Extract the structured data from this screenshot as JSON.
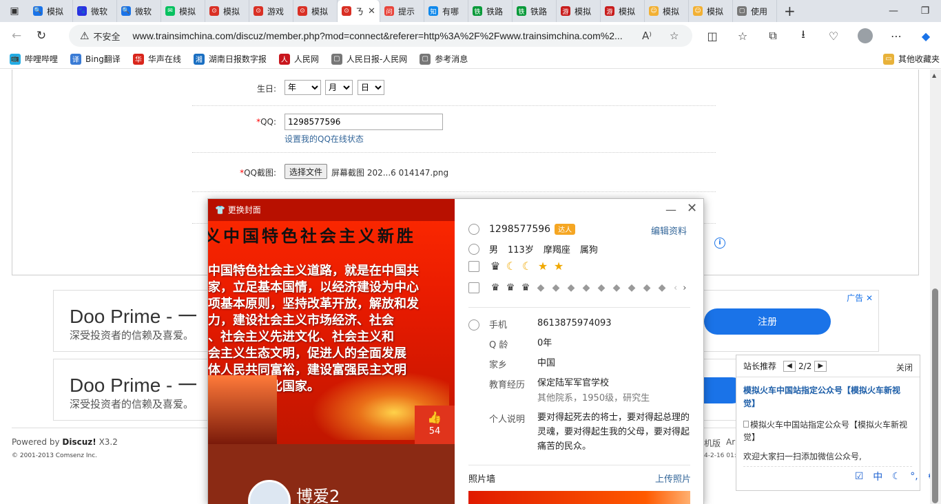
{
  "browser": {
    "tabs": [
      {
        "label": "模拟",
        "color": "#1a73e8",
        "glyph": "🔍"
      },
      {
        "label": "微软",
        "color": "#2932e1",
        "glyph": "🐾"
      },
      {
        "label": "微软",
        "color": "#1a73e8",
        "glyph": "🔍"
      },
      {
        "label": "模拟",
        "color": "#07c160",
        "glyph": "✉"
      },
      {
        "label": "模拟",
        "color": "#d93025",
        "glyph": "⊙"
      },
      {
        "label": "游戏",
        "color": "#d93025",
        "glyph": "⊙"
      },
      {
        "label": "模拟",
        "color": "#d93025",
        "glyph": "⊙"
      },
      {
        "label": "ㄋ",
        "color": "#d93025",
        "glyph": "⊙",
        "active": true
      },
      {
        "label": "提示",
        "color": "#e8453c",
        "glyph": "问"
      },
      {
        "label": "有哪",
        "color": "#0f88eb",
        "glyph": "知"
      },
      {
        "label": "铁路",
        "color": "#0a9a3a",
        "glyph": "铁"
      },
      {
        "label": "铁路",
        "color": "#0a9a3a",
        "glyph": "铁"
      },
      {
        "label": "模拟",
        "color": "#c81c1c",
        "glyph": "游"
      },
      {
        "label": "模拟",
        "color": "#c81c1c",
        "glyph": "游"
      },
      {
        "label": "模拟",
        "color": "#f2b033",
        "glyph": "☺"
      },
      {
        "label": "模拟",
        "color": "#f2b033",
        "glyph": "☺"
      },
      {
        "label": "使用",
        "color": "#777777",
        "glyph": "▢"
      }
    ],
    "address": {
      "security_icon": "warning-icon",
      "security_label": "不安全",
      "url": "www.trainsimchina.com/discuz/member.php?mod=connect&referer=http%3A%2F%2Fwww.trainsimchina.com%2..."
    },
    "bookmarks": [
      {
        "label": "哔哩哔哩",
        "color": "#23ade5",
        "glyph": "📺"
      },
      {
        "label": "Bing翻译",
        "color": "#3a7bd5",
        "glyph": "译"
      },
      {
        "label": "华声在线",
        "color": "#d9261c",
        "glyph": "华"
      },
      {
        "label": "湖南日报数字报",
        "color": "#1a6fc2",
        "glyph": "湘"
      },
      {
        "label": "人民网",
        "color": "#c8161d",
        "glyph": "人"
      },
      {
        "label": "人民日报-人民网",
        "color": "#777777",
        "glyph": "▢"
      },
      {
        "label": "参考消息",
        "color": "#777777",
        "glyph": "▢"
      }
    ],
    "other_bookmarks": "其他收藏夹"
  },
  "form": {
    "birthday_label": "生日:",
    "year": "年",
    "month": "月",
    "day": "日",
    "qq_label": "QQ:",
    "qq_value": "1298577596",
    "qq_status_link": "设置我的QQ在线状态",
    "qq_screenshot_label": "QQ截图:",
    "choose_file": "选择文件",
    "file_name": "屏幕截图 202...6 014147.png",
    "required_mark": "*"
  },
  "ads": [
    {
      "title": "Doo Prime - 一",
      "subtitle": "深受投资者的信赖及喜爱。",
      "button": "注册",
      "tag": "广告 ✕"
    },
    {
      "title": "Doo Prime - 一",
      "subtitle": "深受投资者的信赖及喜爱。"
    }
  ],
  "footer": {
    "powered_prefix": "Powered by",
    "powered_product": "Discuz!",
    "powered_version": "X3.2",
    "copyright": "© 2001-2013 Comsenz Inc.",
    "right_fragment_1": "机版",
    "right_fragment_2": "Ar",
    "right_fragment_3": "4-2-16 01:"
  },
  "profile_popup": {
    "change_cover": "更换封面",
    "cover_headline": "义中国特色社会主义新胜",
    "cover_lines": [
      "中国特色社会主义道路，就是在中国共",
      "家，立足基本国情，以经济建设为中心",
      "项基本原则，坚持改革开放，解放和发",
      "力，建设社会主义市场经济、社会",
      "、社会主义先进文化、社会主义和",
      "会主义生态文明，促进人的全面发展",
      "体人民共同富裕，建设富强民主文明",
      "会主义现代化国家。"
    ],
    "like_count": "54",
    "nickname": "博爱2",
    "qq_number": "1298577596",
    "talent_badge": "达人",
    "edit_profile": "编辑资料",
    "gender": "男",
    "age": "113岁",
    "zodiac": "摩羯座",
    "animal": "属狗",
    "level_icons": [
      "crown-icon",
      "moon-icon",
      "moon-icon",
      "star-icon",
      "star-icon"
    ],
    "badge_icons": [
      "crown-icon",
      "crown-icon",
      "crown-icon",
      "diamond-icon",
      "diamond-icon",
      "diamond-icon",
      "diamond-icon",
      "diamond-icon",
      "diamond-icon",
      "diamond-icon",
      "diamond-icon",
      "diamond-icon"
    ],
    "details": [
      {
        "label": "手机",
        "value": "8613875974093"
      },
      {
        "label": "Q 龄",
        "value": "0年"
      },
      {
        "label": "家乡",
        "value": "中国"
      },
      {
        "label": "教育经历",
        "value": "保定陆军军官学校",
        "sub": "其他院系，1950级，研究生"
      },
      {
        "label": "个人说明",
        "value": "要对得起死去的将士，要对得起总理的灵魂，要对得起生我的父母，要对得起痛苦的民众。"
      }
    ],
    "photo_wall": "照片墙",
    "upload_photo": "上传照片"
  },
  "notice": {
    "title": "站长推荐",
    "page": "2/2",
    "close": "关闭",
    "headline": "模拟火车中国站指定公众号【模拟火车新视觉】",
    "image_alt": "模拟火车中国站指定公众号【模拟火车新视觉】",
    "text": "欢迎大家扫一扫添加微信公众号,"
  },
  "ime": {
    "mode": "中"
  }
}
